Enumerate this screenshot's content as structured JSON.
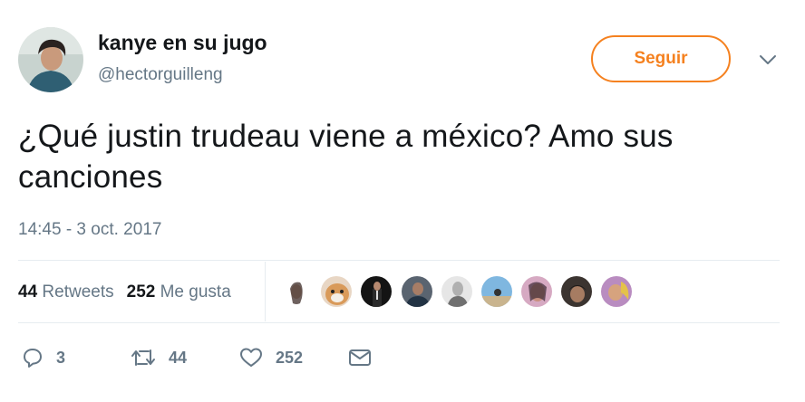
{
  "user": {
    "display_name": "kanye en su jugo",
    "handle": "@hectorguilleng"
  },
  "follow_label": "Seguir",
  "tweet": {
    "text": "¿Qué justin trudeau viene a méxico? Amo sus canciones",
    "timestamp": "14:45 - 3 oct. 2017"
  },
  "stats": {
    "retweets_count": "44",
    "retweets_label": "Retweets",
    "likes_count": "252",
    "likes_label": "Me gusta"
  },
  "actions": {
    "reply_count": "3",
    "retweet_count": "44",
    "like_count": "252"
  },
  "colors": {
    "accent": "#f5811f",
    "secondary_text": "#657786",
    "primary_text": "#14171a",
    "divider": "#e6ecf0"
  },
  "icons": [
    "chevron-down-icon",
    "reply-icon",
    "retweet-icon",
    "heart-icon",
    "message-icon"
  ]
}
